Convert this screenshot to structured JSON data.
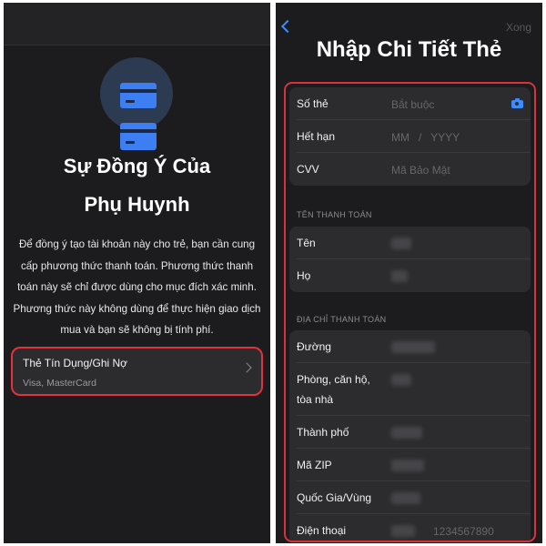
{
  "left_screen": {
    "title_line1": "Sự Đồng Ý Của",
    "title_line2": "Phụ Huynh",
    "description": "Để đồng ý tạo tài khoản này cho trẻ, bạn cần cung cấp phương thức thanh toán. Phương thức thanh toán này sẽ chỉ được dùng cho mục đích xác minh. Phương thức này không dùng để thực hiện giao dịch mua và bạn sẽ không bị tính phí.",
    "payment_option": {
      "title": "Thẻ Tín Dụng/Ghi Nợ",
      "subtitle": "Visa, MasterCard"
    }
  },
  "right_screen": {
    "done_label": "Xong",
    "title": "Nhập Chi Tiết Thẻ",
    "card_group": [
      {
        "label": "Số thẻ",
        "placeholder": "Bắt buộc"
      },
      {
        "label": "Hết hạn",
        "placeholder": "MM   /   YYYY"
      },
      {
        "label": "CVV",
        "placeholder": "Mã Bảo Mật"
      }
    ],
    "billing_name_header": "TÊN THANH TOÁN",
    "name_group": [
      {
        "label": "Tên"
      },
      {
        "label": "Họ"
      }
    ],
    "billing_address_header": "ĐỊA CHỈ THANH TOÁN",
    "address_group": [
      {
        "label": "Đường"
      },
      {
        "label": "Phòng, căn hộ, tòa nhà"
      },
      {
        "label": "Thành phố"
      },
      {
        "label": "Mã ZIP"
      },
      {
        "label": "Quốc Gia/Vùng"
      },
      {
        "label": "Điện thoại",
        "placeholder": "1234567890"
      }
    ]
  },
  "colors": {
    "background": "#1c1c1e",
    "cell": "#2c2c2e",
    "accent_blue": "#3d8bff",
    "highlight_red": "#e3323b"
  }
}
